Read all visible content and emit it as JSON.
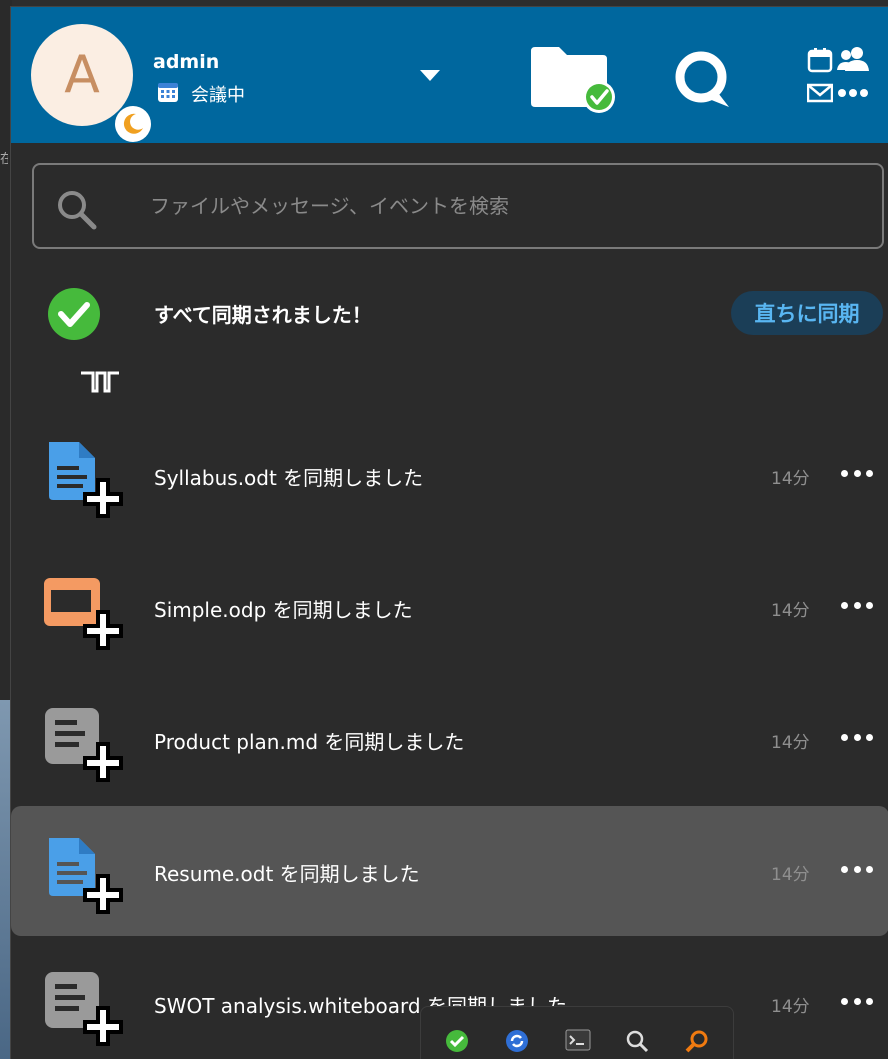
{
  "header": {
    "avatar_letter": "A",
    "username": "admin",
    "status": "会議中",
    "colors": {
      "header_bg": "#00679e",
      "avatar_bg": "#fbeee3",
      "avatar_letter": "#c78e62",
      "away": "#f0a020"
    },
    "icons": [
      "chevron-down-icon",
      "folder-check-icon",
      "talk-icon",
      "calendar-icon",
      "contacts-icon",
      "mail-icon",
      "more-apps-icon"
    ]
  },
  "search": {
    "placeholder": "ファイルやメッセージ、イベントを検索",
    "value": ""
  },
  "sync": {
    "message": "すべて同期されました！",
    "sync_now_label": "直ちに同期",
    "colors": {
      "ok": "#46ba3c",
      "button_bg": "#1b3e57",
      "button_text": "#59b6f2"
    }
  },
  "activities": [
    {
      "text": "Syllabus.odt を同期しました",
      "time": "14分",
      "icon": "document-add-icon",
      "color": "#4a9fe8"
    },
    {
      "text": "Simple.odp を同期しました",
      "time": "14分",
      "icon": "presentation-add-icon",
      "color": "#f49a62"
    },
    {
      "text": "Product plan.md を同期しました",
      "time": "14分",
      "icon": "text-file-add-icon",
      "color": "#9a9a9a"
    },
    {
      "text": "Resume.odt を同期しました",
      "time": "14分",
      "icon": "document-add-icon",
      "color": "#4a9fe8"
    },
    {
      "text": "SWOT analysis.whiteboard を同期しました",
      "time": "14分",
      "icon": "text-file-add-icon",
      "color": "#9a9a9a"
    }
  ],
  "tray": {
    "items": [
      "sync-ok-icon",
      "refresh-icon",
      "terminal-icon",
      "search-icon",
      "find-icon"
    ]
  }
}
